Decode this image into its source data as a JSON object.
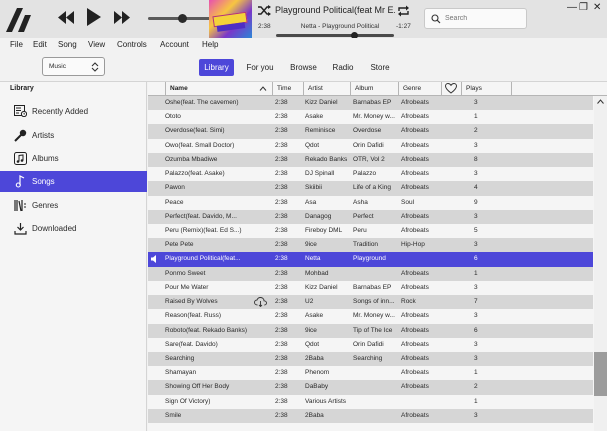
{
  "player": {
    "track_title": "Playground Political(feat Mr E...",
    "artist_album": "Netta - Playground Political",
    "elapsed": "2:38",
    "remaining": "-1:27",
    "progress": 0.66,
    "volume": 0.49
  },
  "search": {
    "placeholder": "Search"
  },
  "window": {
    "minimize": "—",
    "restore": "❐",
    "close": "✕"
  },
  "menu": {
    "items": [
      "File",
      "Edit",
      "Song",
      "View",
      "Controls",
      "Account",
      "Help"
    ]
  },
  "source_select": {
    "value": "Music"
  },
  "tabs": [
    {
      "label": "Library",
      "active": true
    },
    {
      "label": "For you",
      "active": false
    },
    {
      "label": "Browse",
      "active": false
    },
    {
      "label": "Radio",
      "active": false
    },
    {
      "label": "Store",
      "active": false
    }
  ],
  "sidebar": {
    "header": "Library",
    "items": [
      {
        "label": "Recently Added",
        "icon": "recently-added-icon"
      },
      {
        "label": "Artists",
        "icon": "microphone-icon"
      },
      {
        "label": "Albums",
        "icon": "album-icon"
      },
      {
        "label": "Songs",
        "icon": "music-note-icon",
        "active": true
      },
      {
        "label": "Genres",
        "icon": "genres-icon"
      },
      {
        "label": "Downloaded",
        "icon": "download-icon"
      }
    ]
  },
  "table": {
    "columns": [
      "Name",
      "Time",
      "Artist",
      "Album",
      "Genre",
      "Plays"
    ],
    "love_icon": "heart-icon",
    "rows": [
      {
        "name": "Oshe(feat. The cavemen)",
        "time": "2:38",
        "artist": "Kizz Daniel",
        "album": "Barnabas EP",
        "genre": "Afrobeats",
        "plays": "3"
      },
      {
        "name": "Ototo",
        "time": "2:38",
        "artist": "Asake",
        "album": "Mr. Money w...",
        "genre": "Afrobeats",
        "plays": "1"
      },
      {
        "name": "Overdose(feat. Simi)",
        "time": "2:38",
        "artist": "Reminisce",
        "album": "Overdose",
        "genre": "Afrobeats",
        "plays": "2"
      },
      {
        "name": "Owo(feat. Small Doctor)",
        "time": "2:38",
        "artist": "Qdot",
        "album": "Orin Dafidi",
        "genre": "Afrobeats",
        "plays": "3"
      },
      {
        "name": "Ozumba Mbadiwe",
        "time": "2:38",
        "artist": "Rekado Banks",
        "album": "OTR, Vol 2",
        "genre": "Afrobeats",
        "plays": "8"
      },
      {
        "name": "Palazzo(feat. Asake)",
        "time": "2:38",
        "artist": "DJ Spinall",
        "album": "Palazzo",
        "genre": "Afrobeats",
        "plays": "3"
      },
      {
        "name": "Pawon",
        "time": "2:38",
        "artist": "Skiibii",
        "album": "Life of a King",
        "genre": "Afrobeats",
        "plays": "4"
      },
      {
        "name": "Peace",
        "time": "2:38",
        "artist": "Asa",
        "album": "Asha",
        "genre": "Soul",
        "plays": "9"
      },
      {
        "name": "Perfect(feat. Davido, M...",
        "time": "2:38",
        "artist": "Danagog",
        "album": "Perfect",
        "genre": "Afrobeats",
        "plays": "3"
      },
      {
        "name": "Peru (Remix)(feat. Ed S...)",
        "time": "2:38",
        "artist": "Fireboy DML",
        "album": "Peru",
        "genre": "Afrobeats",
        "plays": "5"
      },
      {
        "name": "Pete Pete",
        "time": "2:38",
        "artist": "9ice",
        "album": "Tradition",
        "genre": "Hip-Hop",
        "plays": "3"
      },
      {
        "name": "Playground Political(feat...",
        "time": "2:38",
        "artist": "Netta",
        "album": "Playground",
        "genre": "",
        "plays": "6",
        "selected": true,
        "playing": true
      },
      {
        "name": "Ponmo Sweet",
        "time": "2:38",
        "artist": "Mohbad",
        "album": "",
        "genre": "Afrobeats",
        "plays": "1"
      },
      {
        "name": "Pour Me Water",
        "time": "2:38",
        "artist": "Kizz Daniel",
        "album": "Barnabas EP",
        "genre": "Afrobeats",
        "plays": "3"
      },
      {
        "name": "Raised By Wolves",
        "time": "2:38",
        "artist": "U2",
        "album": "Songs of inn...",
        "genre": "Rock",
        "plays": "7",
        "cloud": true
      },
      {
        "name": "Reason(feat. Russ)",
        "time": "2:38",
        "artist": "Asake",
        "album": "Mr. Money w...",
        "genre": "Afrobeats",
        "plays": "3"
      },
      {
        "name": "Roboto(feat. Rekado Banks)",
        "time": "2:38",
        "artist": "9ice",
        "album": "Tip of The Ice",
        "genre": "Afrobeats",
        "plays": "6"
      },
      {
        "name": "Sare(feat. Davido)",
        "time": "2:38",
        "artist": "Qdot",
        "album": "Orin Dafidi",
        "genre": "Afrobeats",
        "plays": "3"
      },
      {
        "name": "Searching",
        "time": "2:38",
        "artist": "2Baba",
        "album": "Searching",
        "genre": "Afrobeats",
        "plays": "3"
      },
      {
        "name": "Shamayan",
        "time": "2:38",
        "artist": "Phenom",
        "album": "",
        "genre": "Afrobeats",
        "plays": "1"
      },
      {
        "name": "Showing Off Her Body",
        "time": "2:38",
        "artist": "DaBaby",
        "album": "",
        "genre": "Afrobeats",
        "plays": "2"
      },
      {
        "name": "Sign Of Victory)",
        "time": "2:38",
        "artist": "Various Artists",
        "album": "",
        "genre": "",
        "plays": "1"
      },
      {
        "name": "Smile",
        "time": "2:38",
        "artist": "2Baba",
        "album": "",
        "genre": "Afrobeats",
        "plays": "3"
      }
    ]
  },
  "colors": {
    "accent": "#4d47d9",
    "row_alt": "#d6d6d6",
    "background": "#f2f2f2"
  }
}
